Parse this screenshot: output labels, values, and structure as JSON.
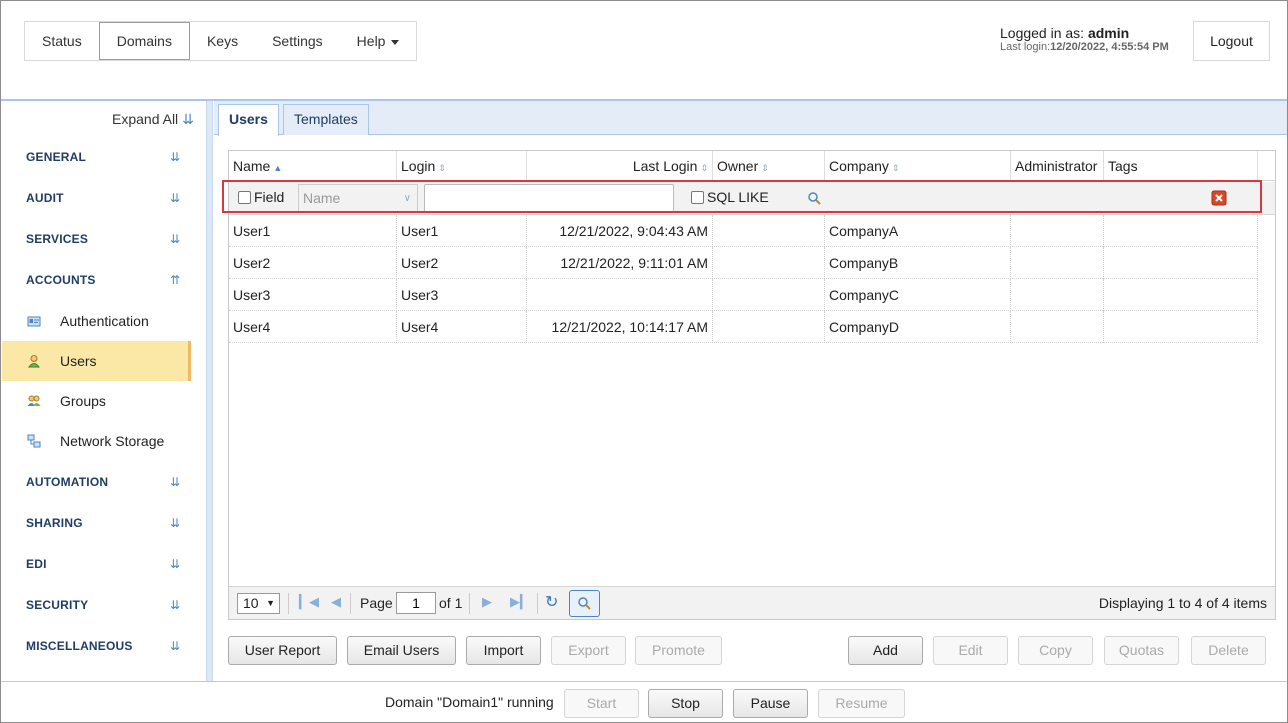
{
  "topnav": {
    "items": [
      "Status",
      "Domains",
      "Keys",
      "Settings",
      "Help"
    ],
    "active": "Domains"
  },
  "userinfo": {
    "logged_in_label": "Logged in as:",
    "user": "admin",
    "last_login_label": "Last login:",
    "last_login": "12/20/2022, 4:55:54 PM"
  },
  "logout_label": "Logout",
  "sidebar": {
    "expand_all": "Expand All",
    "sections": [
      "GENERAL",
      "AUDIT",
      "SERVICES",
      "ACCOUNTS",
      "AUTOMATION",
      "SHARING",
      "EDI",
      "SECURITY",
      "MISCELLANEOUS"
    ],
    "account_items": [
      "Authentication",
      "Users",
      "Groups",
      "Network Storage"
    ],
    "active_item": "Users"
  },
  "tabs": [
    "Users",
    "Templates"
  ],
  "grid": {
    "columns": [
      "Name",
      "Login",
      "Last Login",
      "Owner",
      "Company",
      "Administrator",
      "Tags"
    ],
    "filter": {
      "field_label": "Field",
      "select_placeholder": "Name",
      "value": "",
      "sql_like_label": "SQL LIKE"
    },
    "rows": [
      {
        "name": "User1",
        "login": "User1",
        "last_login": "12/21/2022, 9:04:43 AM",
        "owner": "",
        "company": "CompanyA",
        "admin": "",
        "tags": ""
      },
      {
        "name": "User2",
        "login": "User2",
        "last_login": "12/21/2022, 9:11:01 AM",
        "owner": "",
        "company": "CompanyB",
        "admin": "",
        "tags": ""
      },
      {
        "name": "User3",
        "login": "User3",
        "last_login": "",
        "owner": "",
        "company": "CompanyC",
        "admin": "",
        "tags": ""
      },
      {
        "name": "User4",
        "login": "User4",
        "last_login": "12/21/2022, 10:14:17 AM",
        "owner": "",
        "company": "CompanyD",
        "admin": "",
        "tags": ""
      }
    ],
    "pager": {
      "page_size": "10",
      "page_label": "Page",
      "page": "1",
      "of_label": "of 1",
      "display": "Displaying 1 to 4 of 4 items"
    }
  },
  "actions_left": [
    "User Report",
    "Email Users",
    "Import",
    "Export",
    "Promote"
  ],
  "actions_right": [
    "Add",
    "Edit",
    "Copy",
    "Quotas",
    "Delete"
  ],
  "status": {
    "text": "Domain \"Domain1\" running",
    "buttons": [
      "Start",
      "Stop",
      "Pause",
      "Resume"
    ]
  },
  "colors": {
    "accent": "#4a86c5",
    "active_item_bg": "#fbe7a6",
    "highlight_border": "#d9363e"
  }
}
